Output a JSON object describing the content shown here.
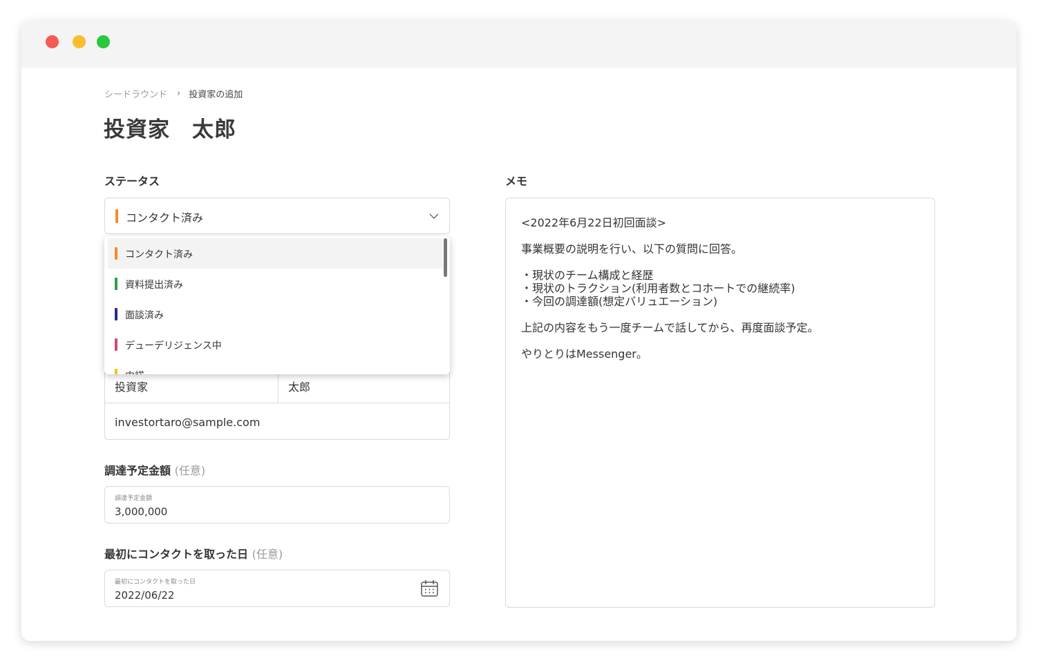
{
  "window": {
    "controls": [
      "close",
      "minimize",
      "maximize"
    ]
  },
  "breadcrumb": {
    "parent": "シードラウンド",
    "separator": "›",
    "current": "投資家の追加"
  },
  "page_title": "投資家　太郎",
  "status": {
    "label": "ステータス",
    "selected": {
      "label": "コンタクト済み",
      "color": "#f28c28"
    },
    "options": [
      {
        "label": "コンタクト済み",
        "color": "#f28c28",
        "highlighted": true
      },
      {
        "label": "資料提出済み",
        "color": "#2e9e4f"
      },
      {
        "label": "面談済み",
        "color": "#1f2f8c"
      },
      {
        "label": "デューデリジェンス中",
        "color": "#d6457a"
      },
      {
        "label": "内諾",
        "color": "#f5c518"
      }
    ]
  },
  "contact": {
    "last_name": "投資家",
    "first_name": "太郎",
    "email": "investortaro@sample.com"
  },
  "amount": {
    "label": "調達予定金額",
    "optional": "(任意)",
    "float_label": "調達予定金額",
    "value": "3,000,000"
  },
  "first_contact": {
    "label": "最初にコンタクトを取った日",
    "optional": "(任意)",
    "float_label": "最初にコンタクトを取った日",
    "value": "2022/06/22",
    "icon": "calendar-icon"
  },
  "memo": {
    "label": "メモ",
    "lines": [
      "<2022年6月22日初回面談>",
      "事業概要の説明を行い、以下の質問に回答。",
      "・現状のチーム構成と経歴",
      "・現状のトラクション(利用者数とコホートでの継続率)",
      "・今回の調達額(想定バリュエーション)",
      "上記の内容をもう一度チームで話してから、再度面談予定。",
      "やりとりはMessenger。"
    ]
  }
}
